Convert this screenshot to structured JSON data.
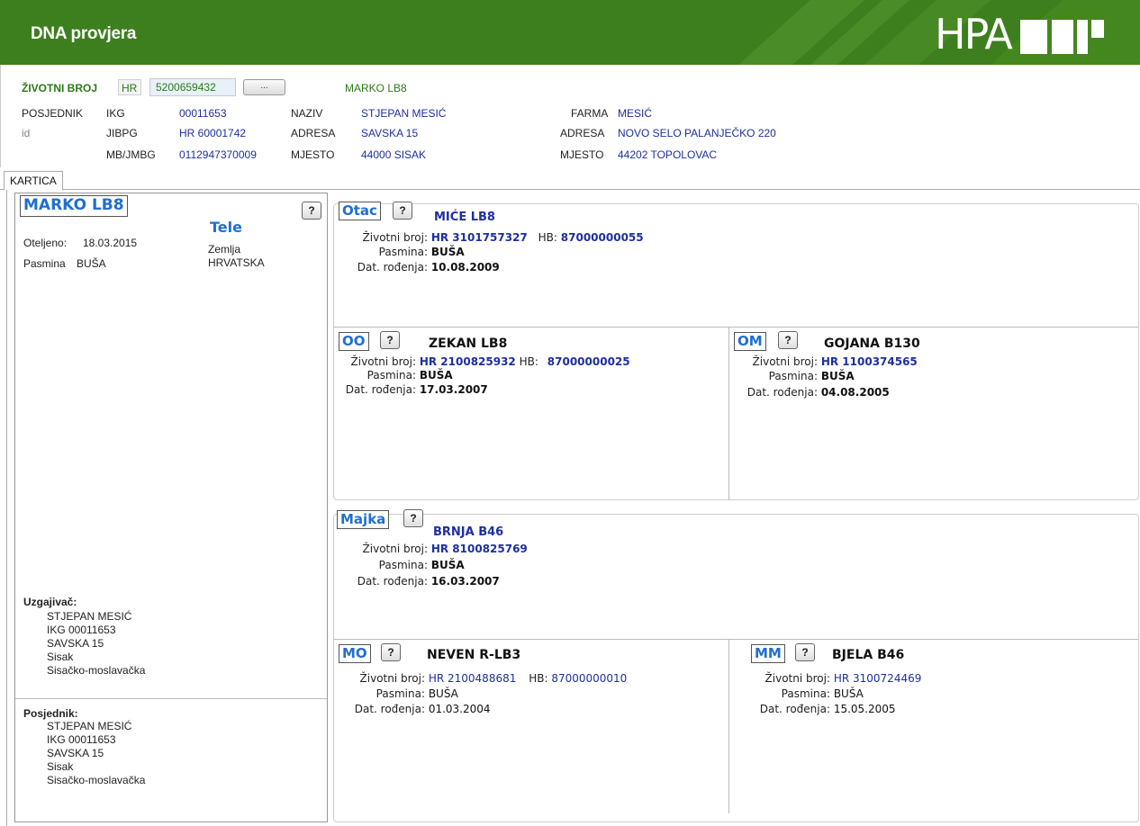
{
  "app": {
    "title": "DNA provjera",
    "logo_text": "HPA"
  },
  "lookup": {
    "label": "ŽIVOTNI BROJ",
    "country": "HR",
    "number": "5200659432",
    "browse_label": "...",
    "animal_name": "MARKO LB8"
  },
  "owner": {
    "posjednik_label": "POSJEDNIK",
    "id_label": "id",
    "ikg_label": "IKG",
    "ikg": "00011653",
    "jibpg_label": "JIBPG",
    "jibpg": "HR 60001742",
    "mb_label": "MB/JMBG",
    "mb": "0112947370009",
    "naziv_label": "NAZIV",
    "naziv": "STJEPAN MESIĆ",
    "adresa_label": "ADRESA",
    "adresa": "SAVSKA 15",
    "mjesto_label": "MJESTO",
    "mjesto": "44000 SISAK",
    "farma_label": "FARMA",
    "farma": "MESIĆ",
    "farm_adresa_label": "ADRESA",
    "farm_adresa": "NOVO SELO PALANJEČKO 220",
    "farm_mjesto_label": "MJESTO",
    "farm_mjesto": "44202 TOPOLOVAC"
  },
  "tabs": [
    {
      "label": "KARTICA"
    }
  ],
  "card": {
    "name": "MARKO LB8",
    "help": "?",
    "category": "Tele",
    "oteljeno_label": "Oteljeno:",
    "oteljeno": "18.03.2015",
    "pasmina_label": "Pasmina",
    "pasmina": "BUŠA",
    "zemlja_label": "Zemlja",
    "zemlja": "HRVATSKA",
    "uzgajivac": {
      "label": "Uzgajivač:",
      "lines": [
        "STJEPAN MESIĆ",
        "IKG 00011653",
        "SAVSKA 15",
        "Sisak",
        "Sisačko-moslavačka"
      ]
    },
    "posjednik": {
      "label": "Posjednik:",
      "lines": [
        "STJEPAN MESIĆ",
        "IKG 00011653",
        "SAVSKA 15",
        "Sisak",
        "Sisačko-moslavačka"
      ]
    }
  },
  "labels": {
    "zb": "Životni broj:",
    "hb": "HB:",
    "pasmina": "Pasmina:",
    "dat": "Dat. rođenja:",
    "help": "?"
  },
  "pedigree": {
    "otac": {
      "tag": "Otac",
      "name": "MIĆE LB8",
      "zb": "HR 3101757327",
      "hb": "87000000055",
      "pasmina": "BUŠA",
      "dat": "10.08.2009"
    },
    "oo": {
      "tag": "OO",
      "name": "ZEKAN LB8",
      "zb": "HR 2100825932",
      "hb": "87000000025",
      "pasmina": "BUŠA",
      "dat": "17.03.2007"
    },
    "om": {
      "tag": "OM",
      "name": "GOJANA B130",
      "zb": "HR 1100374565",
      "pasmina": "BUŠA",
      "dat": "04.08.2005"
    },
    "majka": {
      "tag": "Majka",
      "name": "BRNJA B46",
      "zb": "HR 8100825769",
      "pasmina": "BUŠA",
      "dat": "16.03.2007"
    },
    "mo": {
      "tag": "MO",
      "name": "NEVEN R-LB3",
      "zb": "HR 2100488681",
      "hb": "87000000010",
      "pasmina": "BUŠA",
      "dat": "01.03.2004"
    },
    "mm": {
      "tag": "MM",
      "name": "BJELA B46",
      "zb": "HR 3100724469",
      "pasmina": "BUŠA",
      "dat": "15.05.2005"
    }
  }
}
